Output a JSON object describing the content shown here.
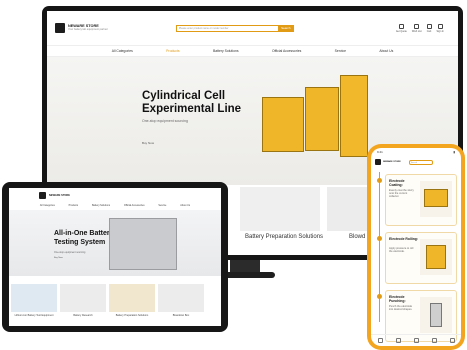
{
  "brand": {
    "name": "NEWARE STORE",
    "tagline": "Your battery lab equipment partner"
  },
  "desktop": {
    "search_placeholder": "Please enter product name or model number",
    "search_button": "Search",
    "icons": [
      {
        "label": "Get Quote",
        "icon": "quote-icon"
      },
      {
        "label": "Wish List",
        "icon": "heart-icon"
      },
      {
        "label": "Cart",
        "icon": "cart-icon"
      },
      {
        "label": "Sign In",
        "icon": "user-icon"
      }
    ],
    "nav": [
      "All Categories",
      "Products",
      "Battery Solutions",
      "Official Accessories",
      "Service",
      "About Us"
    ],
    "banner": {
      "title": "Cylindrical Cell Experimental Line",
      "subtitle": "One-stop equipment sourcing",
      "more": "Buy Now"
    },
    "cards": [
      "Battery Preparation Solutions",
      "Blowd"
    ]
  },
  "tablet": {
    "nav": [
      "All Categories",
      "Products",
      "Battery Solutions",
      "Official Accessories",
      "Service",
      "About Us"
    ],
    "banner": {
      "title": "All-in-One Battery Testing System",
      "subtitle": "One-stop equipment sourcing",
      "more": "Buy Now"
    },
    "cards": [
      "Lithium-Ion Battery Test Equipment",
      "Battery Research",
      "Battery Preparation Solutions",
      "Blowdown Box"
    ]
  },
  "phone": {
    "status_time": "9:41",
    "search_placeholder": "Search",
    "steps": [
      {
        "title": "Electrode Coating:",
        "desc": "Evenly coat the slurry onto the current collector."
      },
      {
        "title": "Electrode Rolling:",
        "desc": "Apply pressure to roll the electrode."
      },
      {
        "title": "Electrode Punching:",
        "desc": "Punch the electrode into desired shapes."
      }
    ]
  },
  "colors": {
    "accent": "#e29b15",
    "phone_frame": "#f3a520",
    "bezel": "#151515"
  }
}
